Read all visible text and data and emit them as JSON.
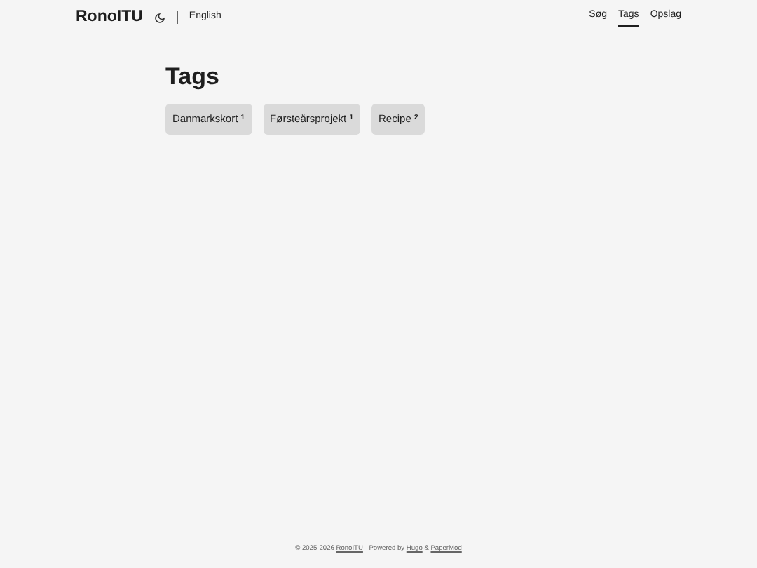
{
  "header": {
    "logo": "RonoITU",
    "language": "English",
    "menu": [
      {
        "label": "Søg",
        "selected": false
      },
      {
        "label": "Tags",
        "selected": true
      },
      {
        "label": "Opslag",
        "selected": false
      }
    ]
  },
  "page": {
    "title": "Tags",
    "tags": [
      {
        "name": "Danmarkskort",
        "count": "1"
      },
      {
        "name": "Førsteårsprojekt",
        "count": "1"
      },
      {
        "name": "Recipe",
        "count": "2"
      }
    ]
  },
  "footer": [
    {
      "text": "© 2025-2026 ",
      "kind": "text"
    },
    {
      "text": "RonoITU",
      "kind": "link"
    },
    {
      "text": " · Powered by ",
      "kind": "text"
    },
    {
      "text": "Hugo",
      "kind": "link"
    },
    {
      "text": " & ",
      "kind": "text"
    },
    {
      "text": "PaperMod",
      "kind": "link"
    }
  ]
}
